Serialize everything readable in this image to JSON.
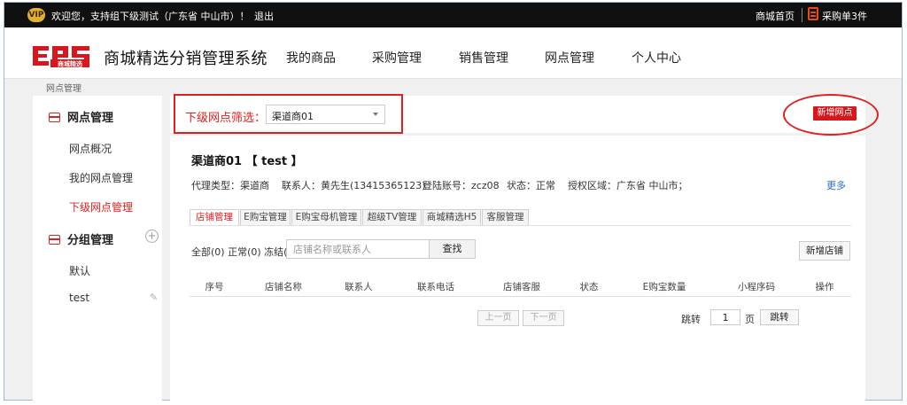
{
  "topbar": {
    "vip_icon": "vip-badge",
    "welcome": "欢迎您，支持组下级测试（广东省 中山市）！",
    "logout": "退出",
    "home": "商城首页",
    "cart_icon": "clipboard-icon",
    "cart": "采购单3件"
  },
  "header": {
    "logo_text": "商城精选",
    "title": "商城精选分销管理系统",
    "nav": [
      "我的商品",
      "采购管理",
      "销售管理",
      "网点管理",
      "个人中心"
    ]
  },
  "breadcrumb": "网点管理",
  "sidebar": {
    "group1": {
      "title": "网点管理",
      "items": [
        "网点概况",
        "我的网点管理",
        "下级网点管理"
      ],
      "active_index": 2
    },
    "group2": {
      "title": "分组管理",
      "items": [
        "默认",
        "test"
      ]
    }
  },
  "filter": {
    "label": "下级网点筛选：",
    "selected": "渠道商01",
    "add_button": "新增网点"
  },
  "dealer": {
    "title": "渠道商01 【 test 】",
    "agent_type": "代理类型：渠道商",
    "contact": "联系人：黄先生(13415365123)",
    "account": "登陆账号：zcz08",
    "status": "状态：正常",
    "region": "授权区域：广东省 中山市；",
    "more": "更多"
  },
  "tabs": [
    "店铺管理",
    "E购宝管理",
    "E购宝母机管理",
    "超级TV管理",
    "商城精选H5",
    "客服管理"
  ],
  "toolbar": {
    "counts": "全部(0) 正常(0) 冻结(0)",
    "search_placeholder": "店铺名称或联系人",
    "search_button": "查找",
    "add_shop": "新增店铺"
  },
  "table": {
    "headers": [
      "序号",
      "店铺名称",
      "联系人",
      "联系电话",
      "店铺客服",
      "状态",
      "E购宝数量",
      "小程序码",
      "操作"
    ]
  },
  "pager": {
    "prev": "上一页",
    "next": "下一页",
    "jump_label": "跳转",
    "page_value": "1",
    "page_unit": "页",
    "jump_button": "跳转"
  },
  "colors": {
    "accent": "#e02020",
    "topbar": "#101010",
    "link": "#2a6dcb"
  }
}
